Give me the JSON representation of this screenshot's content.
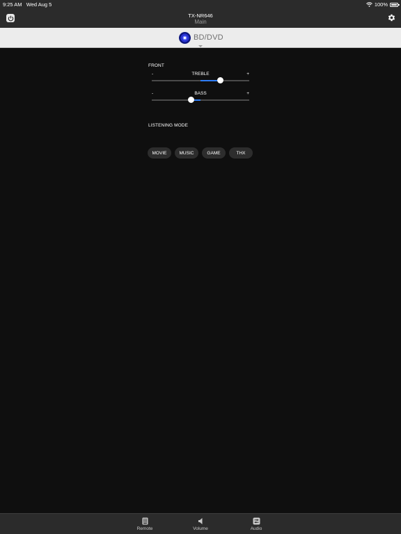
{
  "status_bar": {
    "time": "9:25 AM",
    "date": "Wed Aug 5",
    "battery": "100%",
    "wifi_icon": "wifi-icon",
    "battery_icon": "battery-icon"
  },
  "header": {
    "title": "TX-NR646",
    "subtitle": "Main",
    "power_icon": "power-icon",
    "settings_icon": "gear-icon"
  },
  "source": {
    "label": "BD/DVD",
    "icon": "disc-icon"
  },
  "front": {
    "label": "FRONT",
    "treble": {
      "label": "TREBLE",
      "minus": "-",
      "plus": "+",
      "value": 0.7
    },
    "bass": {
      "label": "BASS",
      "minus": "-",
      "plus": "+",
      "value": 0.4
    }
  },
  "listening_mode": {
    "label": "LISTENING MODE",
    "buttons": [
      "MOVIE",
      "MUSIC",
      "GAME",
      "THX"
    ]
  },
  "tabbar": {
    "items": [
      {
        "label": "Remote",
        "icon": "remote-icon"
      },
      {
        "label": "Volume",
        "icon": "speaker-icon"
      },
      {
        "label": "Audio",
        "icon": "audio-icon"
      }
    ]
  },
  "colors": {
    "accent": "#2f7df6",
    "background": "#0f0f0f",
    "bar": "#2b2b2b"
  }
}
